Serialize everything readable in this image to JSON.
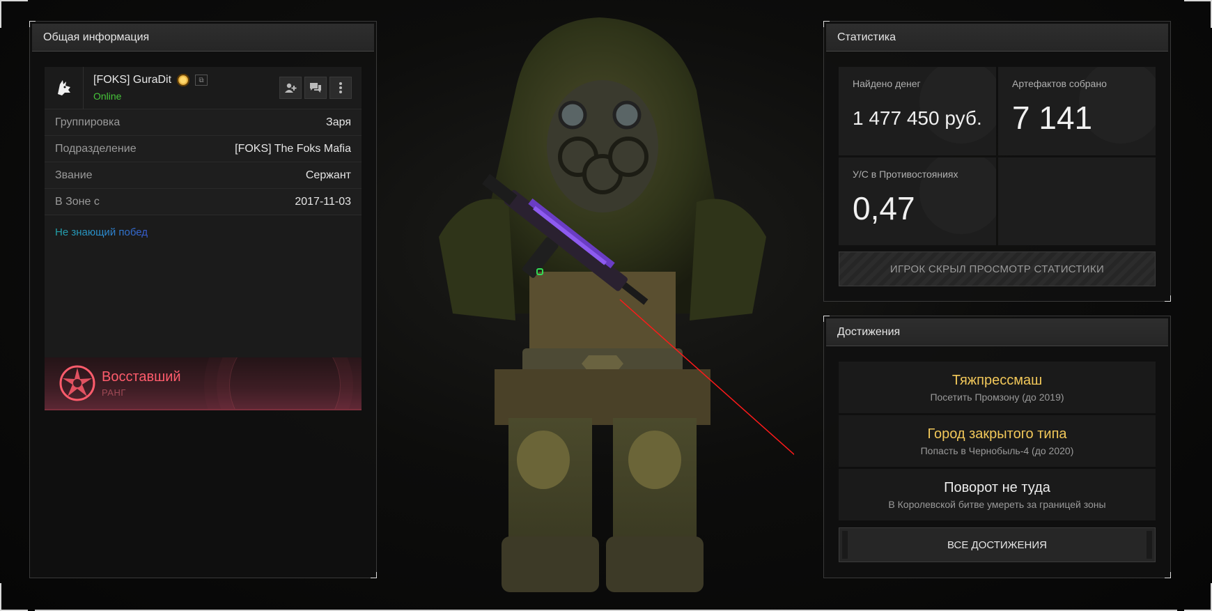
{
  "info": {
    "header": "Общая информация",
    "player": {
      "name": "[FOKS] GuraDit",
      "status": "Online"
    },
    "rows": [
      {
        "label": "Группировка",
        "value": "Заря"
      },
      {
        "label": "Подразделение",
        "value": "[FOKS] The Foks Mafia"
      },
      {
        "label": "Звание",
        "value": "Сержант"
      },
      {
        "label": "В Зоне с",
        "value": "2017-11-03"
      }
    ],
    "motto": "Не знающий побед",
    "rank": {
      "title": "Восставший",
      "subtitle": "РАНГ"
    }
  },
  "stats": {
    "header": "Статистика",
    "cells": [
      {
        "label": "Найдено денег",
        "value": "1 477 450 руб."
      },
      {
        "label": "Артефактов собрано",
        "value": "7 141"
      },
      {
        "label": "У/С в Противостояниях",
        "value": "0,47"
      }
    ],
    "hidden_notice": "ИГРОК СКРЫЛ ПРОСМОТР СТАТИСТИКИ"
  },
  "achievements": {
    "header": "Достижения",
    "items": [
      {
        "title": "Тяжпрессмаш",
        "desc": "Посетить Промзону (до 2019)",
        "color": "#f2c85a"
      },
      {
        "title": "Город закрытого типа",
        "desc": "Попасть в Чернобыль-4 (до 2020)",
        "color": "#f2c85a"
      },
      {
        "title": "Поворот не туда",
        "desc": "В Королевской битве умереть за границей зоны",
        "color": "#ececec"
      }
    ],
    "all_button": "ВСЕ ДОСТИЖЕНИЯ"
  },
  "colors": {
    "online": "#46c53a",
    "rank": "#ff5c6c",
    "gold": "#f2c85a"
  }
}
